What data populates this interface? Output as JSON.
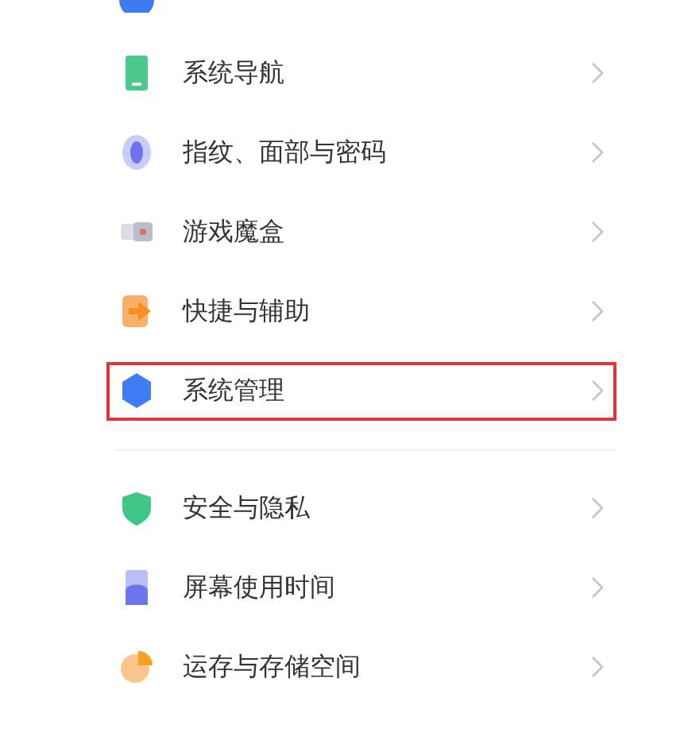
{
  "groups": [
    {
      "items": [
        {
          "label": "系统导航",
          "highlighted": false
        },
        {
          "label": "指纹、面部与密码",
          "highlighted": false
        },
        {
          "label": "游戏魔盒",
          "highlighted": false
        },
        {
          "label": "快捷与辅助",
          "highlighted": false
        },
        {
          "label": "系统管理",
          "highlighted": true
        }
      ]
    },
    {
      "items": [
        {
          "label": "安全与隐私",
          "highlighted": false
        },
        {
          "label": "屏幕使用时间",
          "highlighted": false
        },
        {
          "label": "运存与存储空间",
          "highlighted": false
        }
      ]
    }
  ]
}
